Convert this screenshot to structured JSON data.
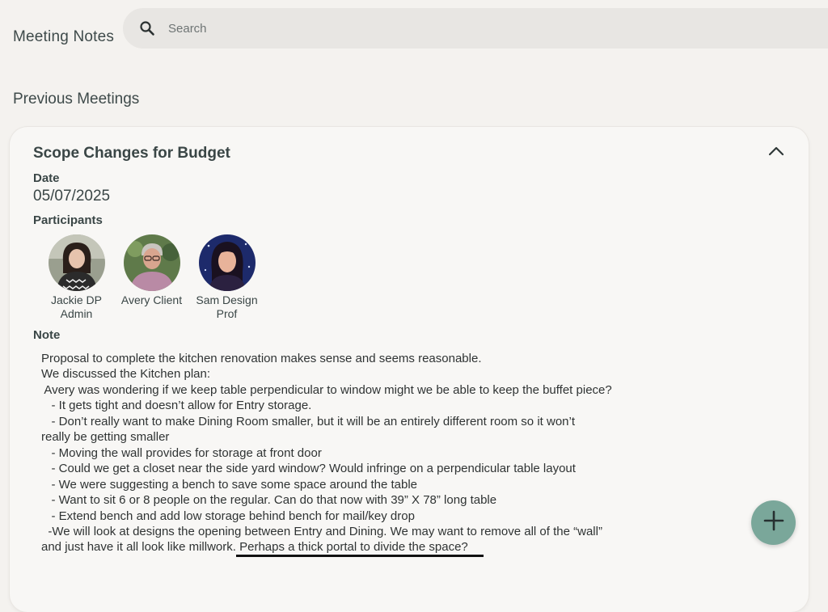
{
  "app": {
    "title": "Meeting Notes"
  },
  "search": {
    "placeholder": "Search",
    "icon": "search-icon"
  },
  "section": {
    "title": "Previous Meetings"
  },
  "meeting": {
    "title": "Scope Changes for Budget",
    "collapse_icon": "chevron-up-icon",
    "date_label": "Date",
    "date": "05/07/2025",
    "participants_label": "Participants",
    "participants": [
      {
        "line1": "Jackie DP",
        "line2": "Admin"
      },
      {
        "line1": "Avery Client",
        "line2": ""
      },
      {
        "line1": "Sam Design",
        "line2": "Prof"
      }
    ],
    "note_label": "Note",
    "note_lines": [
      "Proposal to complete the kitchen renovation makes sense and seems reasonable.",
      "",
      "We discussed the Kitchen plan:",
      " Avery was wondering if we keep table perpendicular to window might we be able to keep the buffet piece?",
      "   - It gets tight and doesn’t allow for Entry storage.",
      "   - Don’t really want to make Dining Room smaller, but it will be an entirely different room so it won’t",
      "really be getting smaller",
      "   - Moving the wall provides for storage at front door",
      "   - Could we get a closet near the side yard window? Would infringe on a perpendicular table layout",
      "   - We were suggesting a bench to save some space around the table",
      "   - Want to sit 6 or 8 people on the regular. Can do that now with 39” X 78” long table",
      "   - Extend bench and add low storage behind bench for mail/key drop",
      "  -We will look at designs the opening between Entry and Dining. We may want to remove all of the “wall”",
      "and just have it all look like millwork. Perhaps a thick portal to divide the space?"
    ]
  },
  "fab": {
    "icon": "plus-icon"
  },
  "colors": {
    "accent": "#7aa79a",
    "background": "#f4f2ef",
    "card": "#f8f7f5",
    "search_bg": "#e8e6e3"
  }
}
